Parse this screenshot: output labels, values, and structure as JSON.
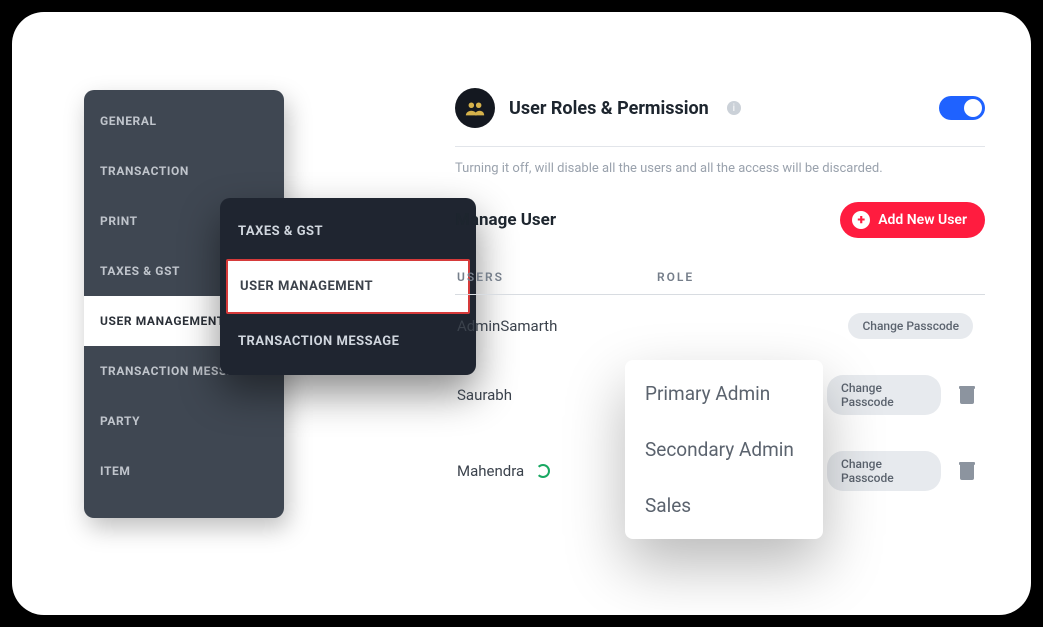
{
  "sidebar": {
    "items": [
      {
        "label": "GENERAL"
      },
      {
        "label": "TRANSACTION"
      },
      {
        "label": "PRINT"
      },
      {
        "label": "TAXES & GST"
      },
      {
        "label": "USER MANAGEMENT"
      },
      {
        "label": "TRANSACTION MESSAGE"
      },
      {
        "label": "PARTY"
      },
      {
        "label": "ITEM"
      }
    ],
    "active_index": 4
  },
  "popover": {
    "items": [
      {
        "label": "TAXES & GST"
      },
      {
        "label": "USER MANAGEMENT"
      },
      {
        "label": "TRANSACTION MESSAGE"
      }
    ],
    "selected_index": 1
  },
  "panel": {
    "title": "User Roles & Permission",
    "info_badge": "i",
    "toggle_on": true,
    "subtext": "Turning it off, will disable all the users and all the access will be discarded.",
    "manage_title": "Manage User",
    "add_button": "Add New User",
    "columns": {
      "users": "USERS",
      "role": "ROLE"
    },
    "rows": [
      {
        "user": "AdminSamarth",
        "role_ghost": "",
        "action": "Change Passcode",
        "deletable": false,
        "sync": false
      },
      {
        "user": "Saurabh",
        "role_ghost": "Secondary",
        "action": "Change Passcode",
        "deletable": true,
        "sync": false
      },
      {
        "user": "Mahendra",
        "role_ghost": "",
        "action": "Change Passcode",
        "deletable": true,
        "sync": true
      }
    ]
  },
  "role_dropdown": {
    "options": [
      "Primary Admin",
      "Secondary Admin",
      "Sales"
    ]
  },
  "colors": {
    "accent": "#ff1c3f",
    "switch": "#1f62ff",
    "dark": "#1f2530",
    "gray": "#3f4752"
  }
}
